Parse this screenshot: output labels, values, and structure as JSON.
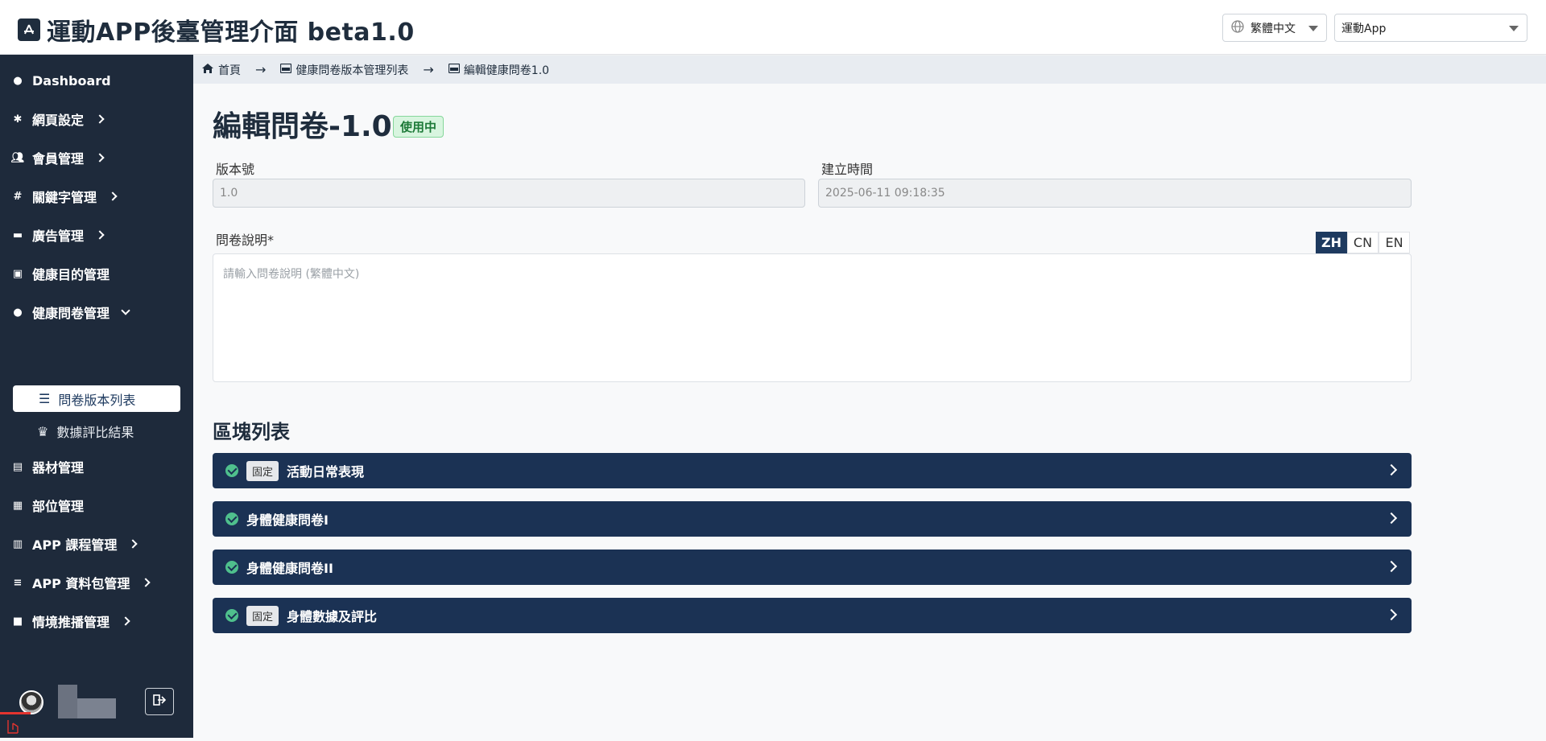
{
  "header": {
    "title": "運動APP後臺管理介面 beta1.0",
    "language_select": "繁體中文",
    "app_select": "運動App"
  },
  "sidebar": {
    "items": [
      {
        "label": "Dashboard",
        "icon": "palette-icon"
      },
      {
        "label": "網頁設定",
        "icon": "gear-icon",
        "expandable": true
      },
      {
        "label": "會員管理",
        "icon": "users-icon",
        "expandable": true
      },
      {
        "label": "關鍵字管理",
        "icon": "hashtag-icon",
        "expandable": true
      },
      {
        "label": "廣告管理",
        "icon": "ad-icon",
        "expandable": true
      },
      {
        "label": "健康目的管理",
        "icon": "medkit-icon"
      },
      {
        "label": "健康問卷管理",
        "icon": "comment-icon",
        "expanded": true
      },
      {
        "label": "器材管理",
        "icon": "toolbox-icon"
      },
      {
        "label": "部位管理",
        "icon": "portrait-icon"
      },
      {
        "label": "APP 課程管理",
        "icon": "book-icon",
        "expandable": true
      },
      {
        "label": "APP 資料包管理",
        "icon": "database-icon",
        "expandable": true
      },
      {
        "label": "情境推播管理",
        "icon": "message-icon",
        "expandable": true
      }
    ],
    "sub_items": [
      {
        "label": "問卷版本列表",
        "icon": "list-icon",
        "active": true
      },
      {
        "label": "數據評比結果",
        "icon": "crown-icon"
      }
    ]
  },
  "breadcrumb": {
    "home": "首頁",
    "list": "健康問卷版本管理列表",
    "current": "編輯健康問卷1.0"
  },
  "page": {
    "title": "編輯問卷-1.0",
    "status": "使用中",
    "version_label": "版本號",
    "version_value": "1.0",
    "created_label": "建立時間",
    "created_value": "2025-06-11 09:18:35",
    "description_label": "問卷說明*",
    "description_placeholder": "請輸入問卷說明 (繁體中文)",
    "lang_tabs": [
      "ZH",
      "CN",
      "EN"
    ],
    "active_lang": "ZH"
  },
  "blocks": {
    "title": "區塊列表",
    "fixed_tag": "固定",
    "items": [
      {
        "label": "活動日常表現",
        "fixed": true
      },
      {
        "label": "身體健康問卷I",
        "fixed": false
      },
      {
        "label": "身體健康問卷II",
        "fixed": false
      },
      {
        "label": "身體數據及評比",
        "fixed": true
      }
    ]
  },
  "colors": {
    "sidebar_bg": "#1e2a3b",
    "block_bg": "#1b3254",
    "active_green": "#4fc08d"
  }
}
